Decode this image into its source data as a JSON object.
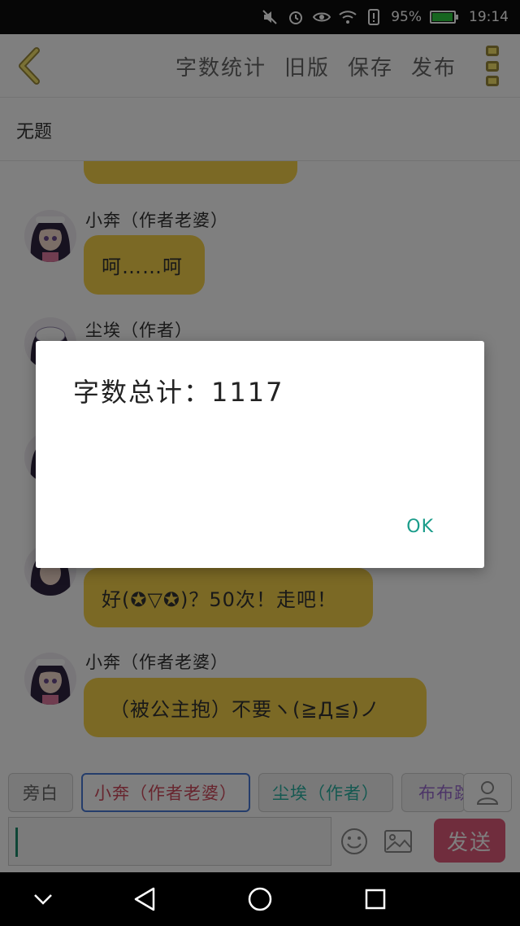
{
  "status_bar": {
    "battery_percent": "95%",
    "time": "19:14",
    "icons": [
      "mute-icon",
      "alarm-icon",
      "eye-icon",
      "wifi-icon",
      "alert-icon",
      "battery-icon"
    ]
  },
  "app_bar": {
    "back_icon": "chevron-left-icon",
    "actions": [
      "字数统计",
      "旧版",
      "保存",
      "发布"
    ],
    "menu_icon": "overflow-menu-icon"
  },
  "document": {
    "title": "无题"
  },
  "chat": {
    "messages": [
      {
        "speaker": "小奔（作者老婆）",
        "text": "呵……呵"
      },
      {
        "speaker": "尘埃（作者）",
        "text": ""
      },
      {
        "speaker": "",
        "text": "好(✪▽✪)？50次！走吧！"
      },
      {
        "speaker": "小奔（作者老婆）",
        "text": "（被公主抱）不要ヽ(≧Д≦)ノ"
      }
    ]
  },
  "roles": {
    "items": [
      "旁白",
      "小奔（作者老婆）",
      "尘埃（作者）",
      "布布跳"
    ],
    "active_index": 1
  },
  "input": {
    "placeholder": "",
    "send_label": "发送"
  },
  "dialog": {
    "message": "字数总计：1117",
    "ok_label": "OK"
  },
  "colors": {
    "bubble": "#f6d24a",
    "send_button": "#e05b7a",
    "dialog_ok": "#1a9c8a",
    "active_role_border": "#4a7bd6"
  }
}
